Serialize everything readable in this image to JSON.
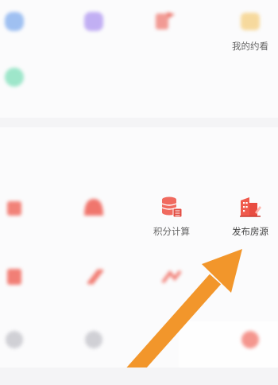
{
  "colors": {
    "accent": "#f05a4c",
    "arrow": "#f2962b",
    "page_bg": "#f4f4f6",
    "card_bg": "#fbfbfc"
  },
  "top_section": {
    "items": [
      {
        "icon": "blue-icon",
        "label": ""
      },
      {
        "icon": "purple-icon",
        "label": ""
      },
      {
        "icon": "red-flag-icon",
        "label": ""
      },
      {
        "icon": "yellow-icon",
        "label": "我的约看"
      },
      {
        "icon": "mint-icon",
        "label": ""
      }
    ]
  },
  "tools_section": {
    "heading": "",
    "row1": [
      {
        "icon": "red-house-icon",
        "label": ""
      },
      {
        "icon": "red-dome-icon",
        "label": ""
      },
      {
        "icon": "database-calculator-icon",
        "label": "积分计算"
      },
      {
        "icon": "building-pen-icon",
        "label": "发布房源"
      }
    ],
    "row2": [
      {
        "icon": "red-icon",
        "label": ""
      },
      {
        "icon": "red-icon",
        "label": ""
      },
      {
        "icon": "red-icon",
        "label": ""
      }
    ],
    "row3": [
      {
        "icon": "gray-icon",
        "label": ""
      },
      {
        "icon": "gray-icon",
        "label": ""
      },
      {
        "icon": "red-icon",
        "label": ""
      }
    ]
  }
}
